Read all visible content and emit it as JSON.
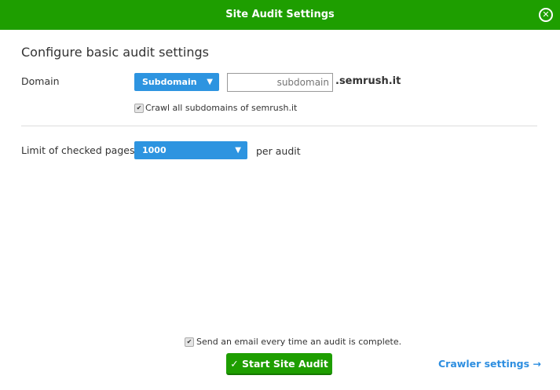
{
  "header": {
    "title": "Site Audit Settings"
  },
  "heading": "Configure basic audit settings",
  "domain": {
    "label": "Domain",
    "type_selected": "Subdomain",
    "input_placeholder": "subdomain",
    "suffix": ".semrush.it",
    "crawl_all_label": "Crawl all subdomains of semrush.it",
    "crawl_all_checked": true
  },
  "limit": {
    "label": "Limit of checked pages",
    "selected": "1000",
    "suffix": "per audit"
  },
  "footer": {
    "email_label": "Send an email every time an audit is complete.",
    "email_checked": true,
    "start_button": "Start Site Audit",
    "crawler_link": "Crawler settings"
  },
  "colors": {
    "brand": "#1e9e00",
    "accent": "#2d94e0"
  }
}
